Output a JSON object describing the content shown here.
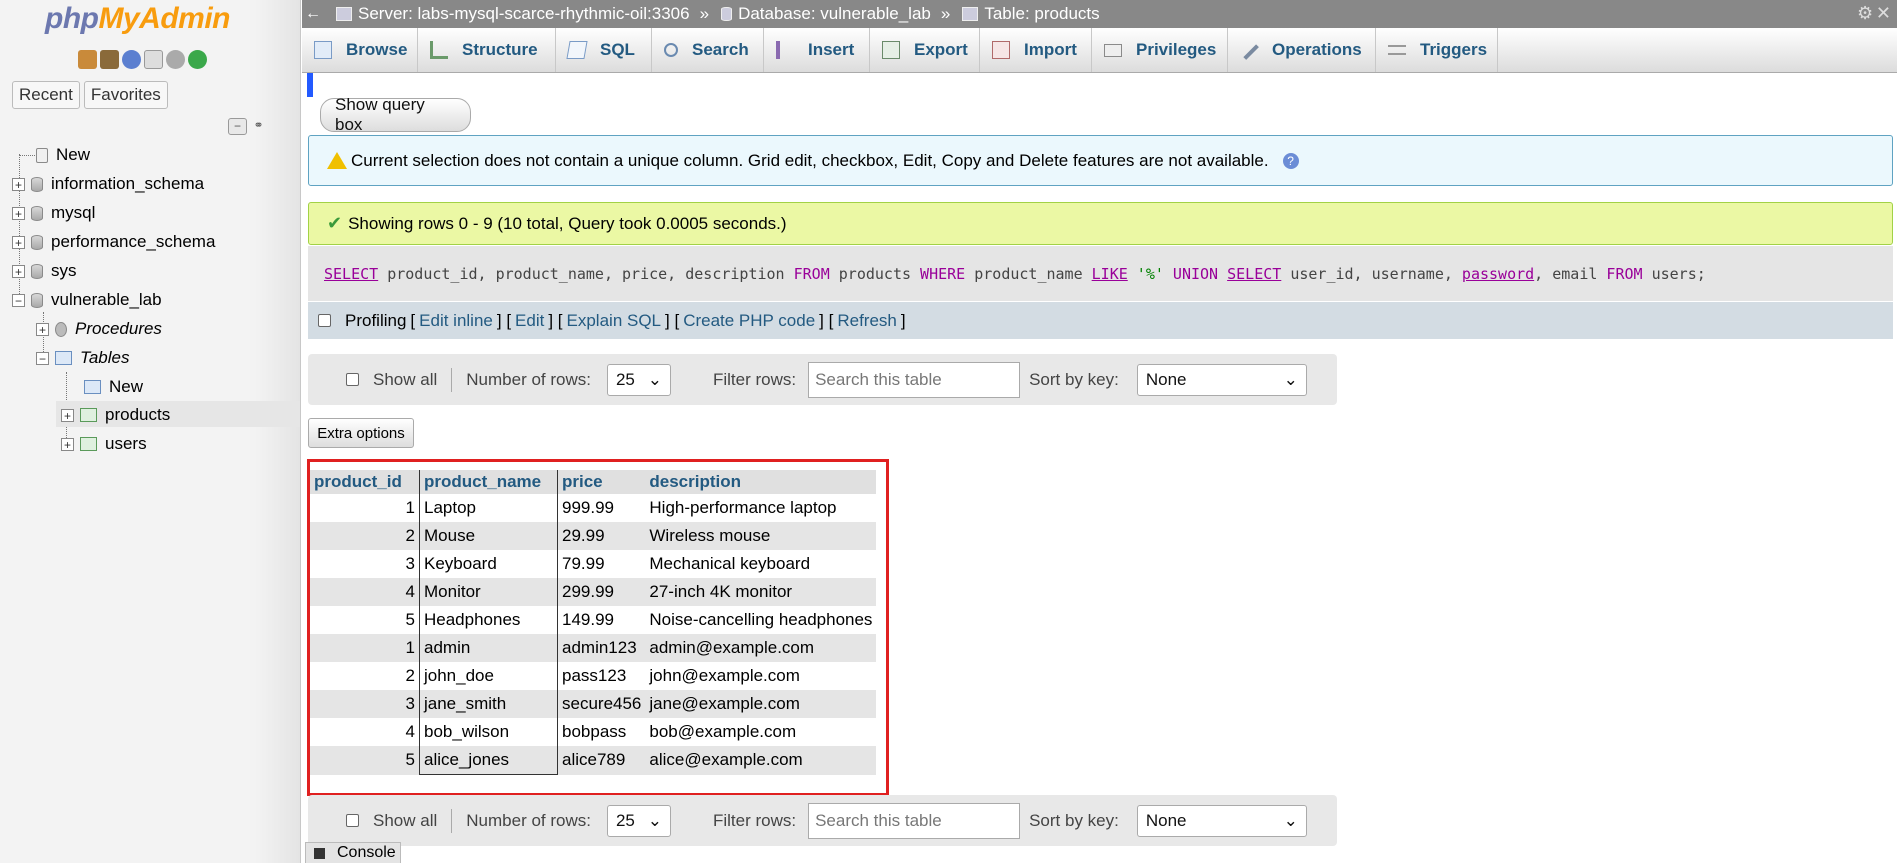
{
  "nav": {
    "logo_php": "php",
    "logo_myadmin": "MyAdmin",
    "tabs": [
      "Recent",
      "Favorites"
    ],
    "tree": {
      "new": "New",
      "databases": [
        "information_schema",
        "mysql",
        "performance_schema",
        "sys",
        "vulnerable_lab"
      ],
      "procedures": "Procedures",
      "tables": "Tables",
      "tables_new": "New",
      "table_items": [
        "products",
        "users"
      ]
    }
  },
  "breadcrumb": {
    "server": "Server: labs-mysql-scarce-rhythmic-oil:3306",
    "database": "Database: vulnerable_lab",
    "table": "Table: products",
    "separator": "»"
  },
  "menu": {
    "tabs": [
      "Browse",
      "Structure",
      "SQL",
      "Search",
      "Insert",
      "Export",
      "Import",
      "Privileges",
      "Operations",
      "Triggers"
    ]
  },
  "main": {
    "show_query_box": "Show query box",
    "notice": "Current selection does not contain a unique column. Grid edit, checkbox, Edit, Copy and Delete features are not available.",
    "success": "Showing rows 0 - 9 (10 total, Query took 0.0005 seconds.)",
    "sql": {
      "select1": "SELECT",
      "cols1": " product_id, product_name, price, description ",
      "from1": "FROM",
      "tbl1": " products ",
      "where": "WHERE",
      "col_pn": " product_name ",
      "like": "LIKE",
      "str": " '%' ",
      "union": "UNION",
      "sp": " ",
      "select2": "SELECT",
      "cols2a": " user_id, username, ",
      "password": "password",
      "cols2b": ", email ",
      "from2": "FROM",
      "tbl2": " users;"
    },
    "profiling": {
      "label": "Profiling",
      "edit_inline": "Edit inline",
      "edit": "Edit",
      "explain": "Explain SQL",
      "create_php": "Create PHP code",
      "refresh": "Refresh"
    },
    "navbar": {
      "show_all": "Show all",
      "number_of_rows_label": "Number of rows:",
      "number_of_rows_value": "25",
      "filter_label": "Filter rows:",
      "filter_placeholder": "Search this table",
      "sort_label": "Sort by key:",
      "sort_value": "None"
    },
    "extra_options": "Extra options",
    "table": {
      "headers": [
        "product_id",
        "product_name",
        "price",
        "description"
      ],
      "rows": [
        [
          "1",
          "Laptop",
          "999.99",
          "High-performance laptop"
        ],
        [
          "2",
          "Mouse",
          "29.99",
          "Wireless mouse"
        ],
        [
          "3",
          "Keyboard",
          "79.99",
          "Mechanical keyboard"
        ],
        [
          "4",
          "Monitor",
          "299.99",
          "27-inch 4K monitor"
        ],
        [
          "5",
          "Headphones",
          "149.99",
          "Noise-cancelling headphones"
        ],
        [
          "1",
          "admin",
          "admin123",
          "admin@example.com"
        ],
        [
          "2",
          "john_doe",
          "pass123",
          "john@example.com"
        ],
        [
          "3",
          "jane_smith",
          "secure456",
          "jane@example.com"
        ],
        [
          "4",
          "bob_wilson",
          "bobpass",
          "bob@example.com"
        ],
        [
          "5",
          "alice_jones",
          "alice789",
          "alice@example.com"
        ]
      ]
    },
    "console": "Console"
  },
  "colors": {
    "link": "#235a81",
    "highlight_box": "#e02020",
    "success_bg": "#ebf8a4",
    "notice_bg": "#ebf8fd"
  }
}
